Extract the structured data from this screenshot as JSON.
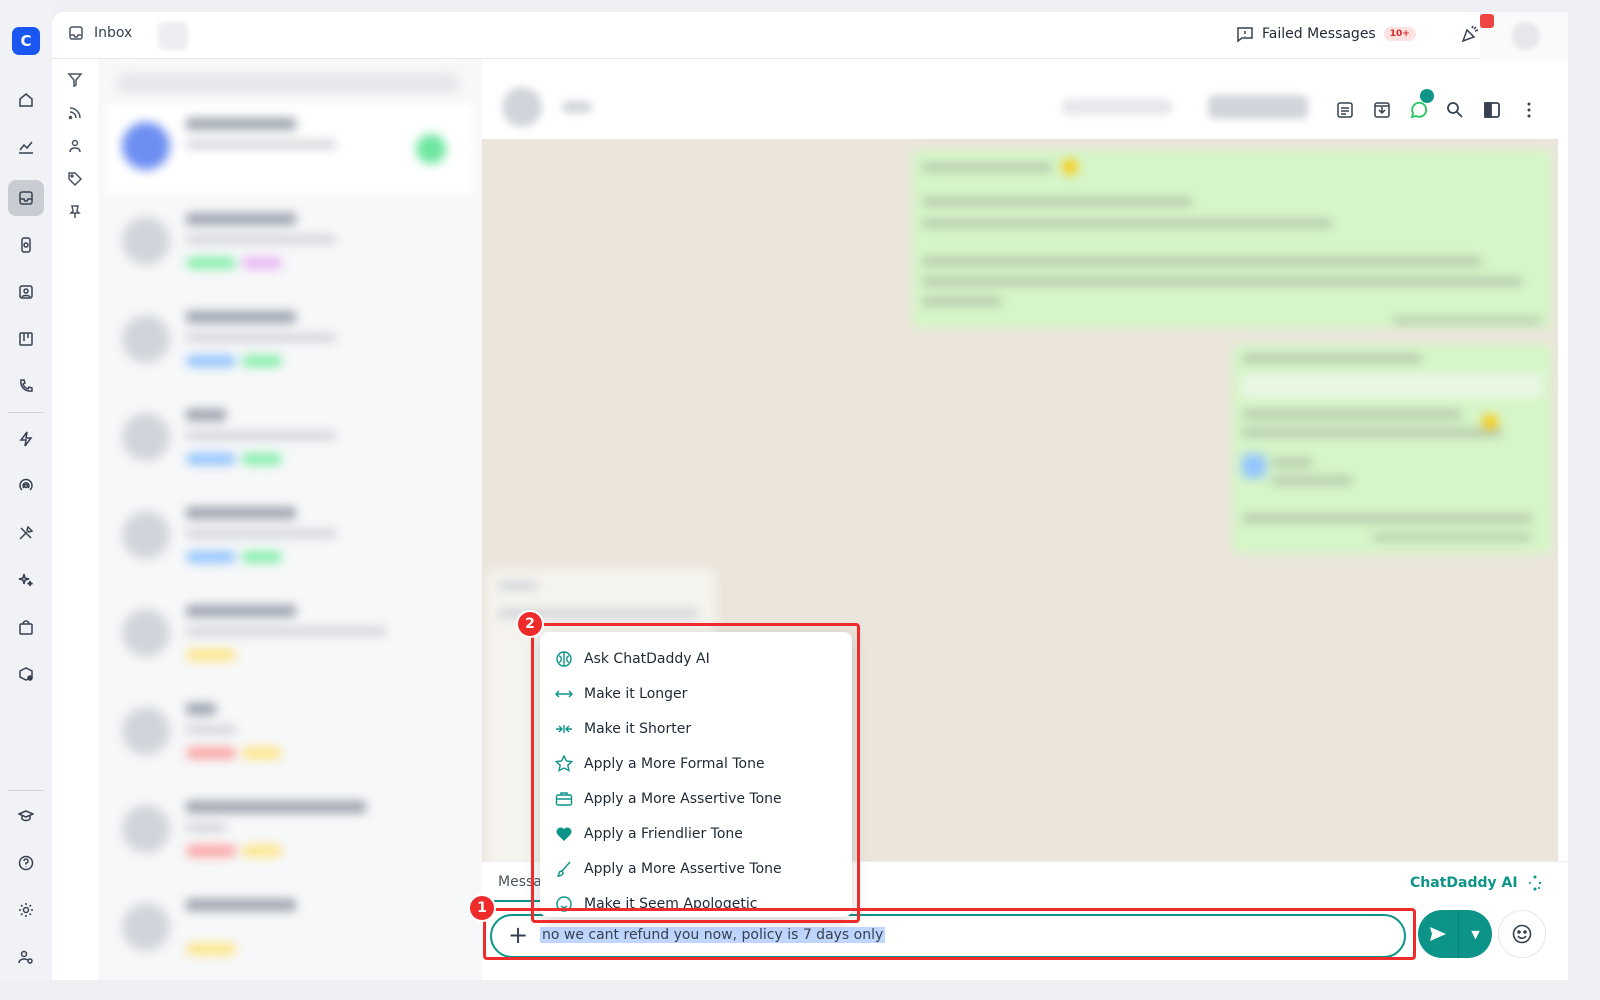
{
  "topbar": {
    "inbox_label": "Inbox",
    "failed_label": "Failed Messages",
    "failed_badge": "10+"
  },
  "composer": {
    "tab_label": "Messa",
    "ai_label": "ChatDaddy AI",
    "input_text": "no we cant refund you now, policy is 7 days only"
  },
  "ai_menu": {
    "items": [
      {
        "label": "Ask ChatDaddy AI",
        "icon": "brain-icon"
      },
      {
        "label": "Make it Longer",
        "icon": "expand-arrows-icon"
      },
      {
        "label": "Make it Shorter",
        "icon": "compress-arrows-icon"
      },
      {
        "label": "Apply a More Formal Tone",
        "icon": "star-icon"
      },
      {
        "label": "Apply a More Assertive Tone",
        "icon": "briefcase-icon"
      },
      {
        "label": "Apply a Friendlier Tone",
        "icon": "heart-icon"
      },
      {
        "label": "Apply a More Assertive Tone",
        "icon": "brush-icon"
      },
      {
        "label": "Make it Seem Apologetic",
        "icon": "smiley-icon"
      }
    ]
  },
  "annotations": [
    "1",
    "2"
  ],
  "colors": {
    "accent": "#0d9488",
    "annotation": "#ef2b2b",
    "brand": "#1a56f0",
    "chat_bg": "#ebe5dc",
    "bubble": "#d6f5c8"
  }
}
